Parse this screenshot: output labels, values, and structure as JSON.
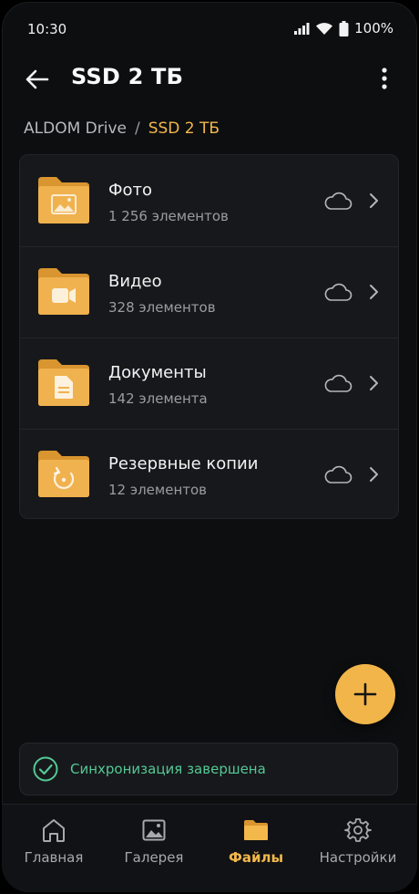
{
  "status_bar": {
    "time": "10:30",
    "battery": "100%"
  },
  "app_bar": {
    "title": "SSD 2 ТБ"
  },
  "breadcrumb": {
    "root": "ALDOM Drive",
    "separator": "/",
    "current": "SSD 2 ТБ"
  },
  "folders": [
    {
      "name": "Фото",
      "count": "1 256 элементов",
      "icon": "image-icon"
    },
    {
      "name": "Видео",
      "count": "328 элементов",
      "icon": "video-icon"
    },
    {
      "name": "Документы",
      "count": "142 элемента",
      "icon": "document-icon"
    },
    {
      "name": "Резервные копии",
      "count": "12 элементов",
      "icon": "backup-icon"
    }
  ],
  "toast": {
    "message": "Синхронизация завершена"
  },
  "bottom_nav": [
    {
      "label": "Главная",
      "icon": "home-icon",
      "active": false
    },
    {
      "label": "Галерея",
      "icon": "gallery-icon",
      "active": false
    },
    {
      "label": "Файлы",
      "icon": "folder-icon",
      "active": true
    },
    {
      "label": "Настройки",
      "icon": "gear-icon",
      "active": false
    }
  ],
  "colors": {
    "accent": "#f2b84b",
    "success": "#54c896",
    "background": "#0d0e10",
    "card": "#17181b"
  }
}
